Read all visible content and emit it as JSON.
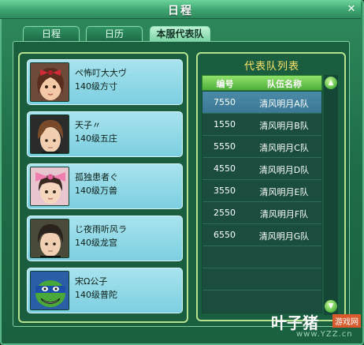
{
  "window": {
    "title": "日程",
    "close_glyph": "✕"
  },
  "tabs": [
    {
      "label": "日程",
      "active": false
    },
    {
      "label": "日历",
      "active": false
    },
    {
      "label": "本服代表队",
      "active": true
    }
  ],
  "team_members": [
    {
      "name": "ペ怖叮大大ヴ",
      "info": "140级方寸",
      "avatar": "girl-red-bow"
    },
    {
      "name": "天子〃",
      "info": "140级五庄",
      "avatar": "boy-brown-hair"
    },
    {
      "name": "孤独患者ぐ",
      "info": "140级万兽",
      "avatar": "girl-pink-bow"
    },
    {
      "name": "じ夜雨听风ラ",
      "info": "140级龙宫",
      "avatar": "boy-dark-hair"
    },
    {
      "name": "宋Ω公子",
      "info": "140级普陀",
      "avatar": "ninja-turtle"
    }
  ],
  "team_list": {
    "title": "代表队列表",
    "headers": {
      "id": "编号",
      "name": "队伍名称"
    },
    "rows": [
      {
        "id": "7550",
        "name": "清风明月A队",
        "selected": true
      },
      {
        "id": "1550",
        "name": "清风明月B队",
        "selected": false
      },
      {
        "id": "5550",
        "name": "清风明月C队",
        "selected": false
      },
      {
        "id": "4550",
        "name": "清风明月D队",
        "selected": false
      },
      {
        "id": "3550",
        "name": "清风明月E队",
        "selected": false
      },
      {
        "id": "2550",
        "name": "清风明月F队",
        "selected": false
      },
      {
        "id": "6550",
        "name": "清风明月G队",
        "selected": false
      }
    ],
    "scroll_up_glyph": "▲",
    "scroll_down_glyph": "▼"
  },
  "watermark": {
    "main": "叶子猪",
    "sub": "游戏网",
    "url": "www.YZZ.cn"
  },
  "colors": {
    "window_bg": "#1f6e48",
    "panel_border": "#b6e28f",
    "card_bg": "#a8e3ee",
    "header_green": "#8fe36a",
    "selected_row": "#4a8ba8",
    "title_yellow": "#ffe56a"
  }
}
